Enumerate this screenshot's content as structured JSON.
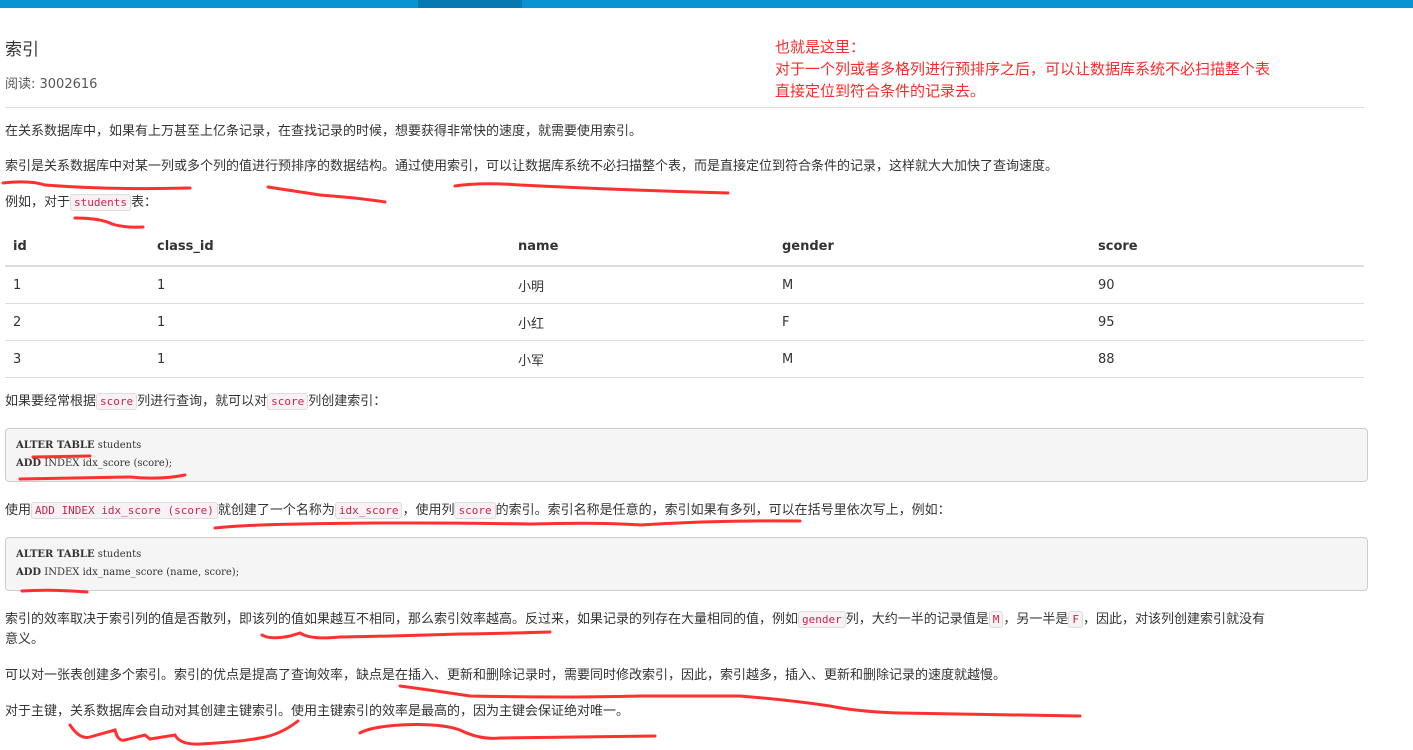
{
  "article": {
    "title": "索引",
    "read_label": "阅读: 3002616",
    "p1": "在关系数据库中，如果有上万甚至上亿条记录，在查找记录的时候，想要获得非常快的速度，就需要使用索引。",
    "p2": "索引是关系数据库中对某一列或多个列的值进行预排序的数据结构。通过使用索引，可以让数据库系统不必扫描整个表，而是直接定位到符合条件的记录，这样就大大加快了查询速度。",
    "p3_pre": "例如，对于",
    "p3_code": "students",
    "p3_post": "表：",
    "table": {
      "headers": [
        "id",
        "class_id",
        "name",
        "gender",
        "score"
      ],
      "rows": [
        [
          "1",
          "1",
          "小明",
          "M",
          "90"
        ],
        [
          "2",
          "1",
          "小红",
          "F",
          "95"
        ],
        [
          "3",
          "1",
          "小军",
          "M",
          "88"
        ]
      ]
    },
    "p4_a": "如果要经常根据",
    "p4_code1": "score",
    "p4_b": "列进行查询，就可以对",
    "p4_code2": "score",
    "p4_c": "列创建索引：",
    "code1_kw1": "ALTER TABLE",
    "code1_l1": " students",
    "code1_kw2": "ADD",
    "code1_l2": " INDEX idx_score (score);",
    "p5_a": "使用",
    "p5_code1": "ADD INDEX idx_score (score)",
    "p5_b": "就创建了一个名称为",
    "p5_code2": "idx_score",
    "p5_c": "，使用列",
    "p5_code3": "score",
    "p5_d": "的索引。索引名称是任意的，索引如果有多列，可以在括号里依次写上，例如：",
    "code2_kw1": "ALTER TABLE",
    "code2_l1": " students",
    "code2_kw2": "ADD",
    "code2_l2": " INDEX idx_name_score (name, score);",
    "p6_a": "索引的效率取决于索引列的值是否散列，即该列的值如果越互不相同，那么索引效率越高。反过来，如果记录的列存在大量相同的值，例如",
    "p6_code1": "gender",
    "p6_b": "列，大约一半的记录值是",
    "p6_code2": "M",
    "p6_c": "，另一半是",
    "p6_code3": "F",
    "p6_d": "，因此，对该列创建索引就没有",
    "p6_e": "意义。",
    "p7": "可以对一张表创建多个索引。索引的优点是提高了查询效率，缺点是在插入、更新和删除记录时，需要同时修改索引，因此，索引越多，插入、更新和删除记录的速度就越慢。",
    "p8": "对于主键，关系数据库会自动对其创建主键索引。使用主键索引的效率是最高的，因为主键会保证绝对唯一。"
  },
  "annotation": {
    "line1": "也就是这里：",
    "line2": "对于一个列或者多格列进行预排序之后，可以让数据库系统不必扫描整个表",
    "line3": "直接定位到符合条件的记录去。",
    "color": "#ff2a2a"
  }
}
